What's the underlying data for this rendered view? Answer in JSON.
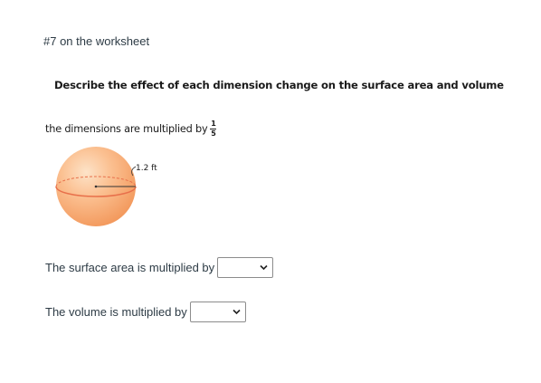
{
  "question": {
    "title": "#7 on the worksheet",
    "instruction": "Describe the effect of each dimension change on the surface area and volume",
    "dimension_text": "the dimensions are multiplied by",
    "fraction": {
      "numerator": "1",
      "denominator": "5"
    }
  },
  "figure": {
    "radius_label": "1.2 ft",
    "colors": {
      "sphere_fill": "#f9b07c",
      "equator": "#e8704b",
      "radius_line": "#333333"
    }
  },
  "answers": {
    "surface_area": {
      "label": "The surface area is multiplied by",
      "selected": ""
    },
    "volume": {
      "label": "The volume is multiplied by",
      "selected": ""
    }
  },
  "icons": {
    "dropdown": "chevron-down-icon"
  }
}
